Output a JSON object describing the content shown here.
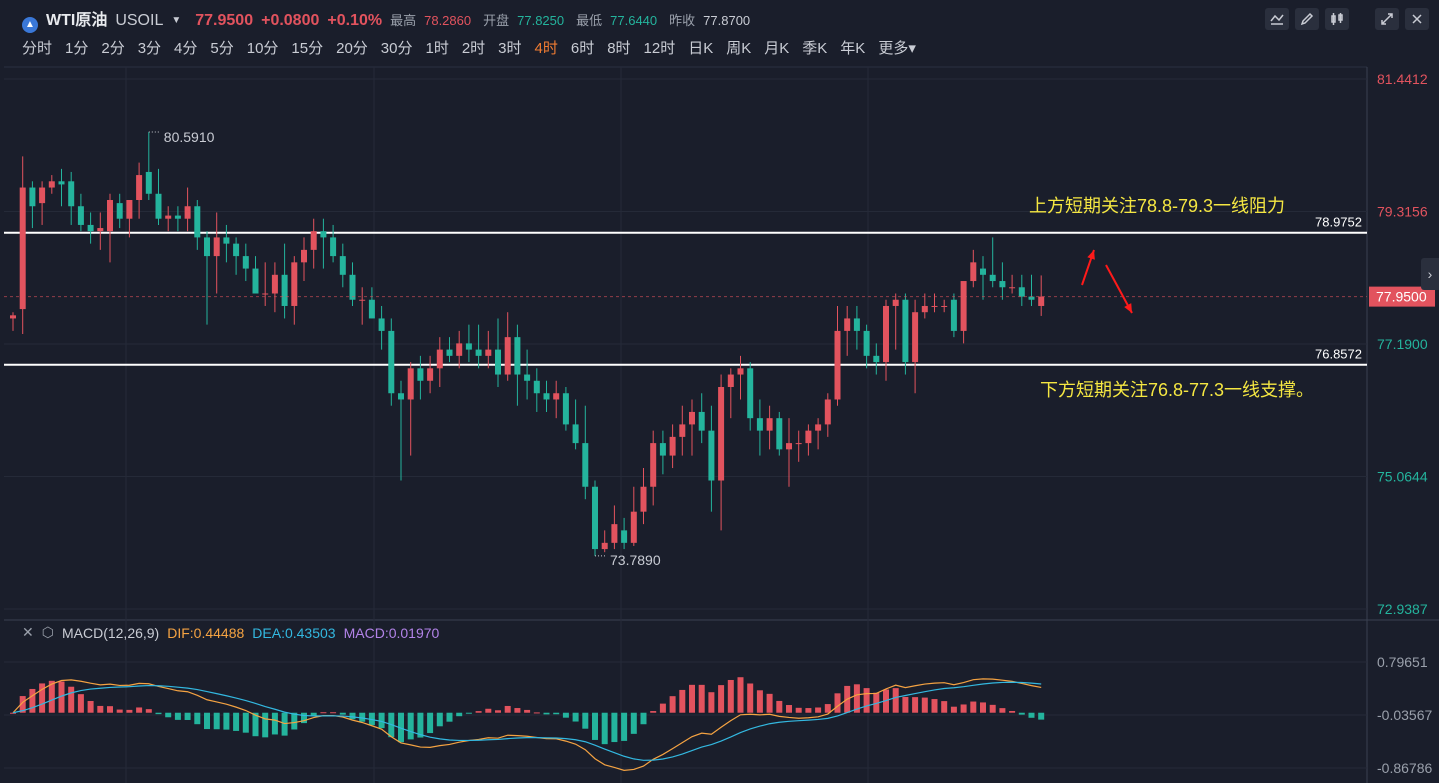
{
  "header": {
    "symbol_name": "WTI原油",
    "symbol_code": "USOIL",
    "price": "77.9500",
    "change": "+0.0800",
    "change_pct": "+0.10%",
    "high_label": "最高",
    "high": "78.2860",
    "open_label": "开盘",
    "open": "77.8250",
    "low_label": "最低",
    "low": "77.6440",
    "prev_label": "昨收",
    "prev": "77.8700"
  },
  "toolbar_icons": [
    "line-chart-icon",
    "draw-pen-icon",
    "candlestick-icon",
    "fullscreen-icon",
    "close-icon"
  ],
  "timeframes": [
    "分时",
    "1分",
    "2分",
    "3分",
    "4分",
    "5分",
    "10分",
    "15分",
    "20分",
    "30分",
    "1时",
    "2时",
    "3时",
    "4时",
    "6时",
    "8时",
    "12时",
    "日K",
    "周K",
    "月K",
    "季K",
    "年K",
    "更多"
  ],
  "active_timeframe": "4时",
  "colors": {
    "up": "#e2535e",
    "down": "#24b49d",
    "dif": "#f5a342",
    "dea": "#33b8e0",
    "macd": "#b283e8",
    "annotation": "#f5e742",
    "active_tab": "#f07c32"
  },
  "chart_data": [
    {
      "type": "candlestick",
      "title": "WTI原油 USOIL 4时",
      "yaxis_ticks": [
        "81.4412",
        "79.3156",
        "77.1900",
        "75.0644",
        "72.9387"
      ],
      "ylim": [
        72.9387,
        81.4412
      ],
      "current_price_label": "77.9500",
      "high_marker": "80.5910",
      "low_marker": "73.7890",
      "hlines": [
        {
          "value": 78.9752,
          "label": "78.9752"
        },
        {
          "value": 76.8572,
          "label": "76.8572"
        }
      ],
      "annotations": [
        "上方短期关注78.8-79.3一线阻力",
        "下方短期关注76.8-77.3一线支撑。"
      ],
      "candles": [
        [
          77.6,
          77.7,
          77.4,
          77.65
        ],
        [
          77.75,
          80.2,
          77.35,
          79.7
        ],
        [
          79.7,
          79.8,
          79.05,
          79.4
        ],
        [
          79.45,
          79.8,
          79.1,
          79.7
        ],
        [
          79.7,
          79.9,
          79.6,
          79.8
        ],
        [
          79.8,
          80.0,
          79.4,
          79.75
        ],
        [
          79.8,
          79.95,
          79.1,
          79.4
        ],
        [
          79.4,
          79.6,
          79.0,
          79.1
        ],
        [
          79.1,
          79.3,
          78.8,
          79.0
        ],
        [
          79.0,
          79.3,
          78.7,
          79.05
        ],
        [
          79.0,
          79.6,
          78.5,
          79.5
        ],
        [
          79.45,
          79.6,
          79.05,
          79.2
        ],
        [
          79.2,
          79.5,
          78.9,
          79.5
        ],
        [
          79.5,
          80.1,
          79.2,
          79.9
        ],
        [
          79.95,
          80.59,
          79.5,
          79.6
        ],
        [
          79.6,
          80.0,
          79.1,
          79.2
        ],
        [
          79.2,
          79.4,
          79.0,
          79.25
        ],
        [
          79.25,
          79.4,
          79.0,
          79.2
        ],
        [
          79.2,
          79.7,
          79.0,
          79.4
        ],
        [
          79.4,
          79.5,
          78.7,
          78.9
        ],
        [
          78.9,
          79.0,
          77.5,
          78.6
        ],
        [
          78.6,
          79.3,
          78.0,
          78.9
        ],
        [
          78.9,
          79.1,
          78.5,
          78.8
        ],
        [
          78.8,
          78.9,
          78.3,
          78.6
        ],
        [
          78.6,
          78.8,
          78.2,
          78.4
        ],
        [
          78.4,
          78.6,
          78.0,
          78.0
        ],
        [
          78.0,
          78.5,
          77.8,
          78.0
        ],
        [
          78.0,
          78.5,
          77.7,
          78.3
        ],
        [
          78.3,
          78.8,
          77.6,
          77.8
        ],
        [
          77.8,
          78.6,
          77.5,
          78.5
        ],
        [
          78.5,
          78.9,
          78.2,
          78.7
        ],
        [
          78.7,
          79.2,
          78.4,
          79.0
        ],
        [
          79.0,
          79.2,
          78.4,
          78.9
        ],
        [
          78.9,
          79.1,
          78.5,
          78.6
        ],
        [
          78.6,
          78.8,
          78.1,
          78.3
        ],
        [
          78.3,
          78.5,
          77.8,
          77.9
        ],
        [
          77.9,
          78.1,
          77.5,
          77.9
        ],
        [
          77.9,
          78.1,
          77.6,
          77.6
        ],
        [
          77.6,
          77.8,
          77.1,
          77.4
        ],
        [
          77.4,
          77.6,
          76.2,
          76.4
        ],
        [
          76.4,
          76.6,
          75.0,
          76.3
        ],
        [
          76.3,
          76.9,
          75.4,
          76.8
        ],
        [
          76.8,
          77.0,
          76.3,
          76.6
        ],
        [
          76.6,
          77.0,
          76.4,
          76.8
        ],
        [
          76.8,
          77.3,
          76.5,
          77.1
        ],
        [
          77.1,
          77.3,
          76.9,
          77.0
        ],
        [
          77.0,
          77.4,
          76.8,
          77.2
        ],
        [
          77.2,
          77.5,
          76.9,
          77.1
        ],
        [
          77.1,
          77.5,
          76.8,
          77.0
        ],
        [
          77.0,
          77.4,
          76.8,
          77.1
        ],
        [
          77.1,
          77.6,
          76.5,
          76.7
        ],
        [
          76.7,
          77.7,
          76.6,
          77.3
        ],
        [
          77.3,
          77.5,
          76.2,
          76.7
        ],
        [
          76.7,
          77.1,
          76.3,
          76.6
        ],
        [
          76.6,
          76.8,
          76.1,
          76.4
        ],
        [
          76.4,
          76.6,
          76.1,
          76.3
        ],
        [
          76.3,
          76.6,
          76.0,
          76.4
        ],
        [
          76.4,
          76.5,
          75.8,
          75.9
        ],
        [
          75.9,
          76.3,
          75.5,
          75.6
        ],
        [
          75.6,
          76.2,
          74.7,
          74.9
        ],
        [
          74.9,
          75.0,
          73.79,
          73.9
        ],
        [
          73.9,
          74.2,
          73.85,
          74.0
        ],
        [
          74.0,
          74.6,
          73.9,
          74.3
        ],
        [
          74.2,
          74.4,
          73.9,
          74.0
        ],
        [
          74.0,
          74.9,
          73.95,
          74.5
        ],
        [
          74.5,
          75.2,
          74.3,
          74.9
        ],
        [
          74.9,
          75.8,
          74.6,
          75.6
        ],
        [
          75.6,
          75.8,
          75.1,
          75.4
        ],
        [
          75.4,
          75.9,
          75.2,
          75.7
        ],
        [
          75.7,
          76.2,
          75.4,
          75.9
        ],
        [
          75.9,
          76.3,
          75.4,
          76.1
        ],
        [
          76.1,
          76.4,
          75.6,
          75.8
        ],
        [
          75.8,
          76.2,
          74.5,
          75.0
        ],
        [
          75.0,
          76.7,
          74.2,
          76.5
        ],
        [
          76.5,
          76.8,
          76.0,
          76.7
        ],
        [
          76.7,
          77.0,
          76.3,
          76.8
        ],
        [
          76.8,
          76.9,
          75.8,
          76.0
        ],
        [
          76.0,
          76.3,
          75.4,
          75.8
        ],
        [
          75.8,
          76.2,
          75.5,
          76.0
        ],
        [
          76.0,
          76.1,
          75.4,
          75.5
        ],
        [
          75.5,
          76.0,
          74.9,
          75.6
        ],
        [
          75.6,
          75.8,
          75.3,
          75.6
        ],
        [
          75.6,
          75.9,
          75.4,
          75.8
        ],
        [
          75.8,
          76.0,
          75.5,
          75.9
        ],
        [
          75.9,
          76.4,
          75.7,
          76.3
        ],
        [
          76.3,
          77.8,
          76.2,
          77.4
        ],
        [
          77.4,
          77.8,
          77.0,
          77.6
        ],
        [
          77.6,
          77.8,
          77.1,
          77.4
        ],
        [
          77.4,
          77.5,
          76.8,
          77.0
        ],
        [
          77.0,
          77.2,
          76.7,
          76.9
        ],
        [
          76.9,
          77.9,
          76.6,
          77.8
        ],
        [
          77.8,
          78.0,
          77.1,
          77.9
        ],
        [
          77.9,
          78.0,
          76.7,
          76.9
        ],
        [
          76.9,
          77.9,
          76.4,
          77.7
        ],
        [
          77.7,
          78.0,
          77.6,
          77.8
        ],
        [
          77.8,
          78.0,
          77.7,
          77.8
        ],
        [
          77.8,
          77.9,
          77.7,
          77.8
        ],
        [
          77.9,
          78.0,
          77.3,
          77.4
        ],
        [
          77.4,
          78.0,
          77.2,
          78.2
        ],
        [
          78.2,
          78.7,
          78.1,
          78.5
        ],
        [
          78.4,
          78.6,
          77.9,
          78.3
        ],
        [
          78.3,
          78.9,
          78.1,
          78.2
        ],
        [
          78.2,
          78.5,
          77.9,
          78.1
        ],
        [
          78.1,
          78.3,
          78.0,
          78.1
        ],
        [
          78.1,
          78.3,
          77.8,
          77.95
        ],
        [
          77.95,
          78.3,
          77.8,
          77.9
        ],
        [
          77.8,
          78.29,
          77.64,
          77.95
        ]
      ]
    },
    {
      "type": "macd",
      "title": "MACD(12,26,9)",
      "params": "MACD(12,26,9)",
      "dif_label": "DIF:0.44488",
      "dea_label": "DEA:0.43503",
      "macd_label": "MACD:0.01970",
      "yaxis_ticks": [
        "0.79651",
        "-0.03567",
        "-0.86786"
      ],
      "ylim": [
        -0.86786,
        0.79651
      ]
    }
  ]
}
